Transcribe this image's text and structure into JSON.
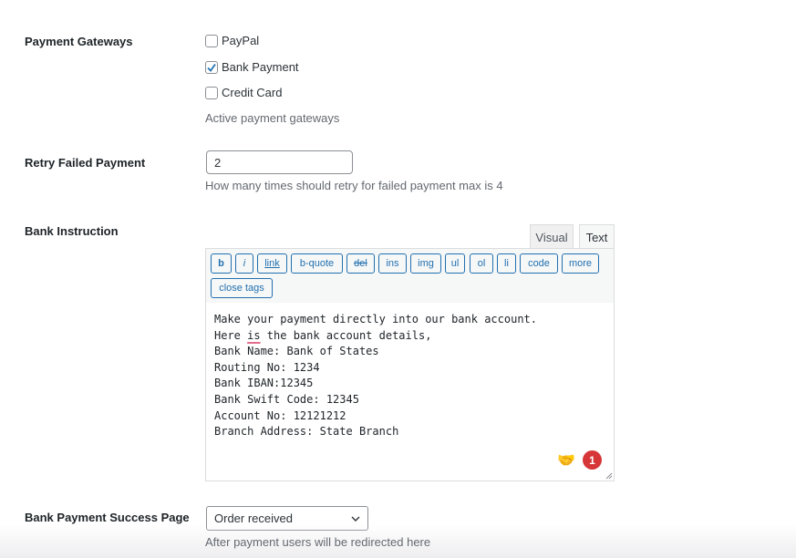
{
  "payment_gateways": {
    "label": "Payment Gateways",
    "options": [
      {
        "label": "PayPal",
        "checked": false
      },
      {
        "label": "Bank Payment",
        "checked": true
      },
      {
        "label": "Credit Card",
        "checked": false
      }
    ],
    "description": "Active payment gateways"
  },
  "retry_failed_payment": {
    "label": "Retry Failed Payment",
    "value": "2",
    "description": "How many times should retry for failed payment max is 4"
  },
  "bank_instruction": {
    "label": "Bank Instruction",
    "tabs": [
      {
        "label": "Visual",
        "active": false
      },
      {
        "label": "Text",
        "active": true
      }
    ],
    "toolbar_buttons": [
      "b",
      "i",
      "link",
      "b-quote",
      "del",
      "ins",
      "img",
      "ul",
      "ol",
      "li",
      "code",
      "more",
      "close tags"
    ],
    "content_lines": [
      "Make your payment directly into our bank account.",
      "Here is the bank account details,",
      "Bank Name: Bank of States",
      "Routing No: 1234",
      "Bank IBAN:12345",
      "Bank Swift Code: 12345",
      "Account No: 12121212",
      "Branch Address: State Branch"
    ],
    "spellcheck_word": "is",
    "extension_icon": "handshake-icon",
    "notification_count": "1"
  },
  "bank_payment_success_page": {
    "label": "Bank Payment Success Page",
    "selected": "Order received",
    "description": "After payment users will be redirected here"
  },
  "colors": {
    "accent": "#2271b1",
    "badge": "#d63638",
    "description": "#646970"
  }
}
